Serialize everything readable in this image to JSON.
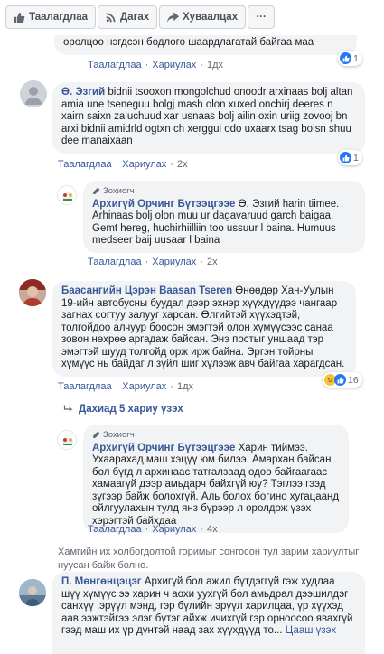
{
  "action_bar": {
    "like_label": "Таалагдлаа",
    "follow_label": "Дагах",
    "share_label": "Хуваалцах",
    "more_label": "···"
  },
  "comments": [
    {
      "text": "оролцоо нэгдсэн бодлого шаардлагатай байгаа маа",
      "like": "Таалагдлаа",
      "reply": "Хариулах",
      "time": "1дх",
      "reactions": "1"
    },
    {
      "author": "Ө. Эзгий",
      "text": "bidnii tsooxon mongolchud onoodr arxinaas bolj altan amia une tseneguu bolgj mash olon xuxed onchirj deeres n xairn saixn zaluchuud xar usnaas bolj ailin oxin uriig zovooj bn arxi bidnii amidrld ogtxn ch xerggui odo uxaarx tsag bolsn shuu dee manaixaan",
      "like": "Таалагдлаа",
      "reply": "Хариулах",
      "time": "2х",
      "reactions": "1"
    },
    {
      "badge": "Зохиогч",
      "author": "Архигүй Орчинг Бүтээцгээе",
      "text": "Ө. Эзгий harin tiimee. Arhinaas bolj olon muu ur dagavaruud garch baigaa. Gemt hereg, huchirhiilliin too ussuur l baina. Humuus medseer baij uusaar l baina",
      "like": "Таалагдлаа",
      "reply": "Хариулах",
      "time": "2х"
    },
    {
      "author": "Баасангийн Цэрэн Baasan Tseren",
      "text": "Өнөөдөр Хан-Уулын 19-ийн автобусны буудал дээр эхнэр хүүхдүүдээ чангаар загнах согтуу залууг харсан. Өлгийтэй хүүхэдтэй, толгойдоо алчуур боосон эмэгтэй олон хүмүүсээс санаа зовон нөхрөө аргадаж байсан. Энэ постыг уншаад тэр эмэгтэй шууд толгойд орж ирж байна. Эргэн тойрны хүмүүс нь байдаг л зүйл шиг хүлээж авч байгаа харагдсан.",
      "like": "Таалагдлаа",
      "reply": "Хариулах",
      "time": "1дх",
      "reactions": "16"
    },
    {
      "view_replies": "Дахиад 5 хариу үзэх"
    },
    {
      "badge": "Зохиогч",
      "author": "Архигүй Орчинг Бүтээцгээе",
      "text": "Харин тиймээ. Ухаарахад маш хэцүү юм билээ. Амархан байсан бол бүгд л архинаас татгалзаад одоо байгаагаас хамаагүй дээр амьдарч байхгүй юу? Тэглээ гээд зүгээр байж болохгүй. Аль болох богино хугацаанд ойлгуулахын тулд янз бүрээр л оролдож үзэх хэрэгтэй байхдаа",
      "like": "Таалагдлаа",
      "reply": "Хариулах",
      "time": "4х"
    },
    {
      "notice": "Хамгийн их холбогдолтой горимыг сонгосон тул зарим хариултыг нуусан байж болно."
    },
    {
      "author": "П. Мөнгөнцэцэг",
      "text": "Архигүй бол ажил бүтдэггүй гэж худлаа шүү хүмүүс ээ харин ч аохи уухгүй бол амьдрал дээшилдэг санхүү ,эрүүл мэнд, гэр бүлийн эрүүл харилцаа, үр хүүхэд аав ээжтэйгээ элэг бүтэг айхж ичихгүй гэр орноосоо явахгүй гээд маш их үр дүнтэй наад зах хүүхдүүд то...",
      "more": "Цааш үзэх"
    }
  ]
}
